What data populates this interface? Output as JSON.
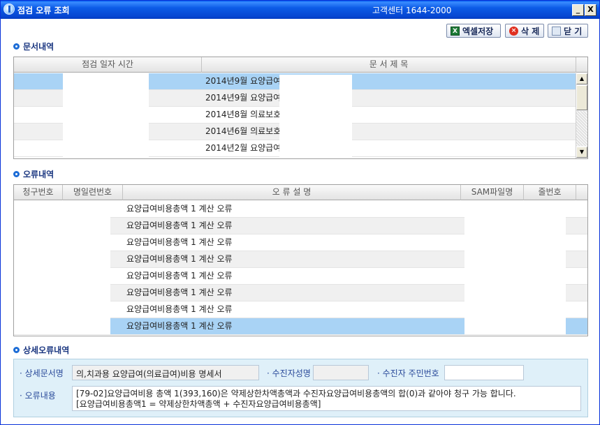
{
  "window": {
    "title": "점검 오류 조회",
    "callcenter": "고객센터 1644-2000",
    "minimize_symbol": "_",
    "close_symbol": "X"
  },
  "toolbar": {
    "excel_label": "엑셀저장",
    "delete_label": "삭 제",
    "close_label": "닫 기"
  },
  "doc_section": {
    "title": "문서내역",
    "columns": [
      "점검 일자 시간",
      "문 서 제 목"
    ],
    "rows": [
      {
        "datetime": "",
        "title": "2014년9월 요양급여"
      },
      {
        "datetime": "",
        "title": "2014년9월 요양급여"
      },
      {
        "datetime": "",
        "title": "2014년8월 의료보호"
      },
      {
        "datetime": "",
        "title": "2014년6월 의료보호"
      },
      {
        "datetime": "",
        "title": "2014년2월 요양급여"
      }
    ],
    "selected_row": 0
  },
  "error_section": {
    "title": "오류내역",
    "columns": [
      "청구번호",
      "명일련번호",
      "오 류 설 명",
      "SAM파일명",
      "줄번호"
    ],
    "rows": [
      {
        "claim_no": "",
        "serial_no": "",
        "desc": "요양급여비용총액 1 계산 오류",
        "sam_file": "",
        "line_no": ""
      },
      {
        "claim_no": "",
        "serial_no": "",
        "desc": "요양급여비용총액 1 계산 오류",
        "sam_file": "",
        "line_no": ""
      },
      {
        "claim_no": "",
        "serial_no": "",
        "desc": "요양급여비용총액 1 계산 오류",
        "sam_file": "",
        "line_no": ""
      },
      {
        "claim_no": "",
        "serial_no": "",
        "desc": "요양급여비용총액 1 계산 오류",
        "sam_file": "",
        "line_no": ""
      },
      {
        "claim_no": "",
        "serial_no": "",
        "desc": "요양급여비용총액 1 계산 오류",
        "sam_file": "",
        "line_no": ""
      },
      {
        "claim_no": "",
        "serial_no": "",
        "desc": "요양급여비용총액 1 계산 오류",
        "sam_file": "",
        "line_no": ""
      },
      {
        "claim_no": "",
        "serial_no": "",
        "desc": "요양급여비용총액 1 계산 오류",
        "sam_file": "",
        "line_no": ""
      },
      {
        "claim_no": "",
        "serial_no": "",
        "desc": "요양급여비용총액 1 계산 오류",
        "sam_file": "",
        "line_no": ""
      }
    ],
    "selected_row": 7
  },
  "detail_section": {
    "title": "상세오류내역",
    "doc_name_label": "· 상세문서명",
    "doc_name_value": "의,치과용 요양급여(의료급여)비용 명세서",
    "patient_name_label": "· 수진자성명",
    "patient_name_value": "",
    "patient_id_label": "· 수진자 주민번호",
    "patient_id_value": "",
    "error_content_label": "· 오류내용",
    "error_content_line1": "[79-02]요양급여비용 총액 1(393,160)은 약제상한차액총액과 수진자요양급여비용총액의 합(0)과 같아야 청구 가능 합니다.",
    "error_content_line2": "[요양급여비용총액1 = 약제상한차액총액 + 수진자요양급여비용총액]"
  },
  "colors": {
    "title_bar": "#0a5ce0",
    "selected_row": "#a9d3f5",
    "alt_row": "#f0f0f0",
    "section_title": "#1a3680",
    "detail_bg": "#dff0f9"
  },
  "icons": {
    "app": "app-logo-icon",
    "excel": "excel-icon",
    "delete": "delete-icon",
    "close": "close-doc-icon",
    "bullet": "section-bullet-icon"
  }
}
